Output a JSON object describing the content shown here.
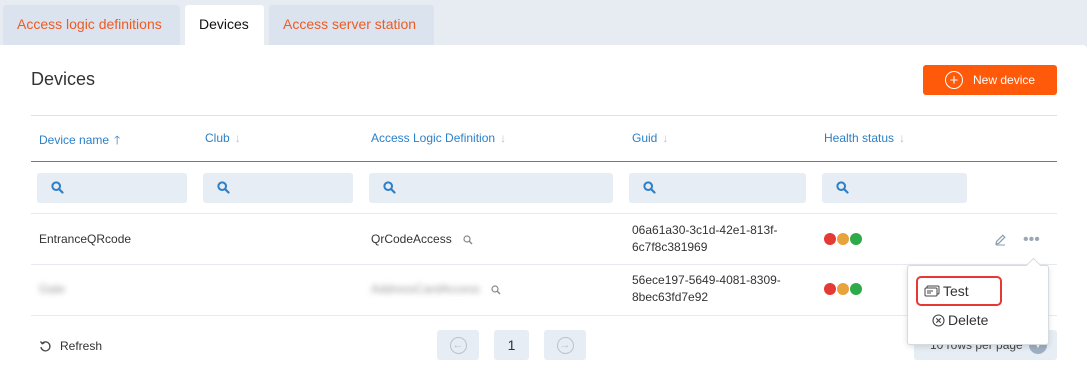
{
  "tabs": [
    {
      "label": "Access logic definitions",
      "active": false
    },
    {
      "label": "Devices",
      "active": true
    },
    {
      "label": "Access server station",
      "active": false
    }
  ],
  "page": {
    "title": "Devices",
    "new_button_label": "New device"
  },
  "table": {
    "columns": [
      {
        "label": "Device name",
        "sort": "ascending"
      },
      {
        "label": "Club",
        "sort": "none"
      },
      {
        "label": "Access Logic Definition",
        "sort": "none"
      },
      {
        "label": "Guid",
        "sort": "none"
      },
      {
        "label": "Health status",
        "sort": "none"
      }
    ],
    "filters": [
      {
        "value": ""
      },
      {
        "value": ""
      },
      {
        "value": ""
      },
      {
        "value": ""
      },
      {
        "value": ""
      }
    ],
    "rows": [
      {
        "device_name": "EntranceQRcode",
        "club": "",
        "access_logic": "QrCodeAccess",
        "guid_line1": "06a61a30-3c1d-42e1-813f-",
        "guid_line2": "6c7f8c381969",
        "health": [
          "#e53935",
          "#e8a33d",
          "#2eaa4a"
        ]
      },
      {
        "device_name": "Gate",
        "club": "",
        "access_logic": "AddressCardAccess",
        "guid_line1": "56ece197-5649-4081-8309-",
        "guid_line2": "8bec63fd7e92",
        "health": [
          "#e53935",
          "#e8a33d",
          "#2eaa4a"
        ]
      }
    ]
  },
  "footer": {
    "refresh_label": "Refresh",
    "current_page": "1",
    "rows_per_page_label": "10 rows per page"
  },
  "context_menu": {
    "items": [
      {
        "label": "Test",
        "highlighted": true
      },
      {
        "label": "Delete",
        "highlighted": false
      }
    ]
  },
  "colors": {
    "accent_orange": "#ff5a0a",
    "tab_text": "#ee5a24",
    "header_blue": "#2c80c8",
    "highlight_red": "#e53935"
  }
}
